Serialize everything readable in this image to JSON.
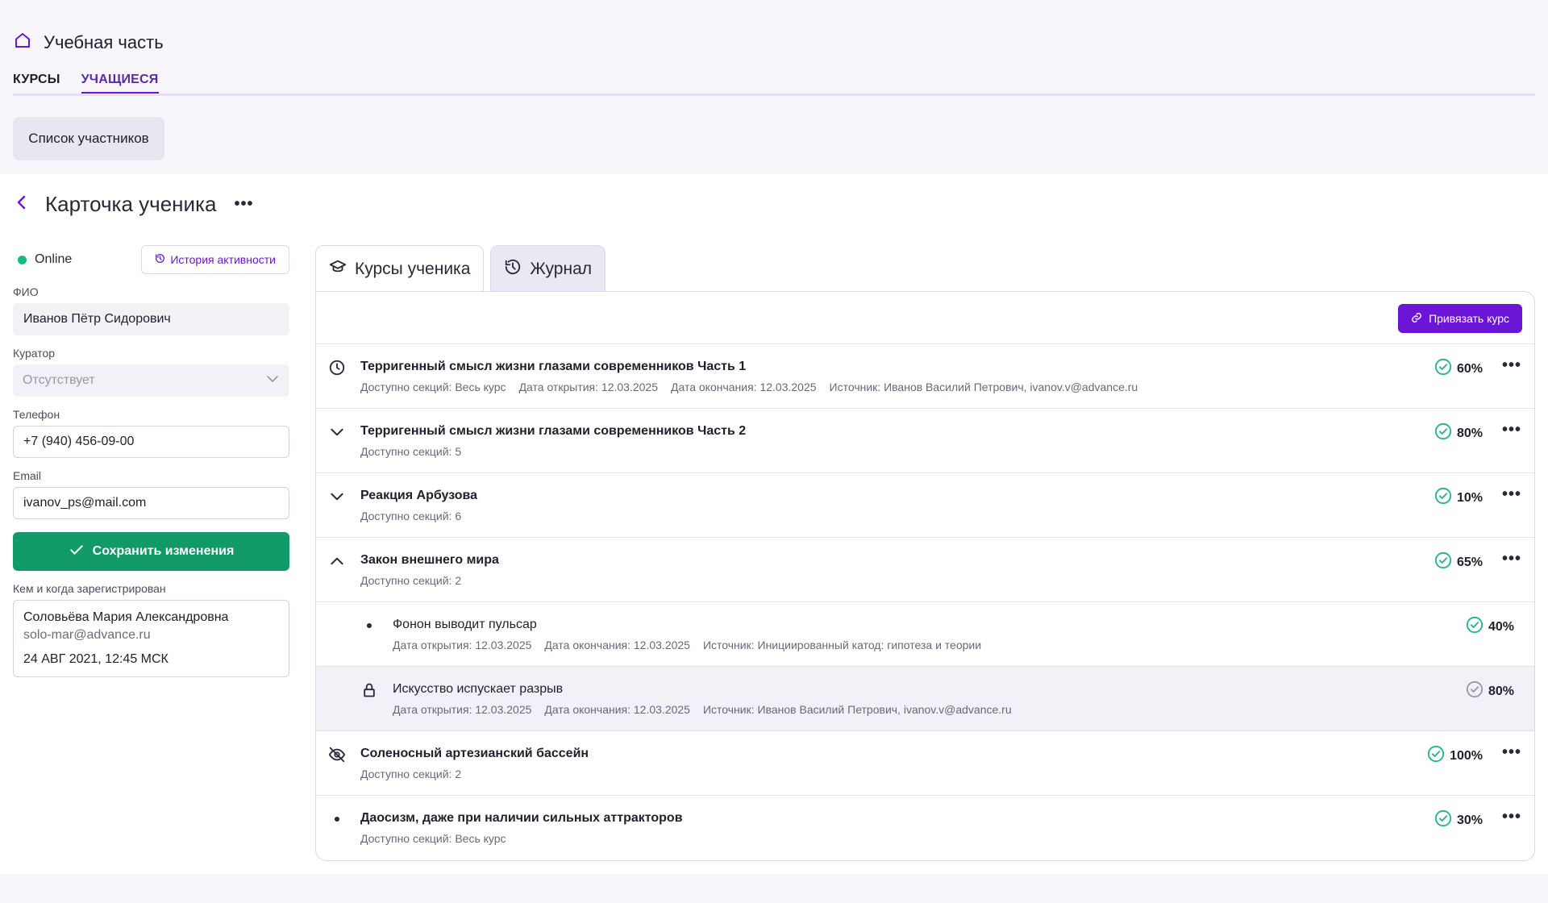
{
  "app": {
    "title": "Учебная часть",
    "tabs": [
      "КУРСЫ",
      "УЧАЩИЕСЯ"
    ],
    "active_tab": 1,
    "list_button": "Список участников"
  },
  "card": {
    "title": "Карточка ученика",
    "more": "•••"
  },
  "profile": {
    "status": "Online",
    "history_button": "История активности",
    "fio_label": "ФИО",
    "fio_value": "Иванов Пётр Сидорович",
    "curator_label": "Куратор",
    "curator_value": "Отсутствует",
    "phone_label": "Телефон",
    "phone_value": "+7 (940) 456-09-00",
    "email_label": "Email",
    "email_value": "ivanov_ps@mail.com",
    "save_button": "Сохранить изменения",
    "registered_label": "Кем и когда зарегистрирован",
    "registered_name": "Соловьёва Мария Александровна",
    "registered_email": "solo-mar@advance.ru",
    "registered_date": "24 АВГ 2021, 12:45 МСК"
  },
  "panel": {
    "tabs": [
      "Курсы ученика",
      "Журнал"
    ],
    "active_tab": 1,
    "bind_button": "Привязать курс",
    "rows": [
      {
        "icon": "clock-icon",
        "title": "Терригенный смысл жизни глазами современников Часть 1",
        "meta": [
          "Доступно секций: Весь курс",
          "Дата открытия: 12.03.2025",
          "Дата окончания: 12.03.2025",
          "Источник: Иванов Василий Петрович, ivanov.v@advance.ru"
        ],
        "percent": "60%"
      },
      {
        "icon": "chevron-down-icon",
        "title": "Терригенный смысл жизни глазами современников Часть 2",
        "meta": [
          "Доступно секций:  5"
        ],
        "percent": "80%"
      },
      {
        "icon": "chevron-down-icon",
        "title": "Реакция Арбузова",
        "meta": [
          "Доступно секций: 6"
        ],
        "percent": "10%"
      },
      {
        "icon": "chevron-up-icon",
        "title": "Закон внешнего мира",
        "meta": [
          "Доступно секций: 2"
        ],
        "percent": "65%"
      },
      {
        "icon": "bullet-icon",
        "sub": true,
        "title": "Фонон выводит пульсар",
        "meta": [
          "Дата открытия: 12.03.2025",
          "Дата окончания: 12.03.2025",
          "Источник: Инициированный катод: гипотеза и теории"
        ],
        "percent": "40%"
      },
      {
        "icon": "lock-icon",
        "sub": true,
        "locked": true,
        "title": "Искусство испускает разрыв",
        "meta": [
          "Дата открытия: 12.03.2025",
          "Дата окончания: 12.03.2025",
          "Источник: Иванов Василий Петрович, ivanov.v@advance.ru"
        ],
        "percent": "80%"
      },
      {
        "icon": "eye-off-icon",
        "title": "Соленосный артезианский бассейн",
        "meta": [
          "Доступно секций: 2"
        ],
        "percent": "100%"
      },
      {
        "icon": "bullet-icon",
        "title": "Даосизм, даже при наличии сильных аттракторов",
        "meta": [
          "Доступно секций: Весь курс"
        ],
        "percent": "30%"
      }
    ]
  },
  "colors": {
    "accent": "#6b15d6",
    "success": "#129968",
    "check": "#19b985",
    "muted_check": "#9a97a8"
  }
}
